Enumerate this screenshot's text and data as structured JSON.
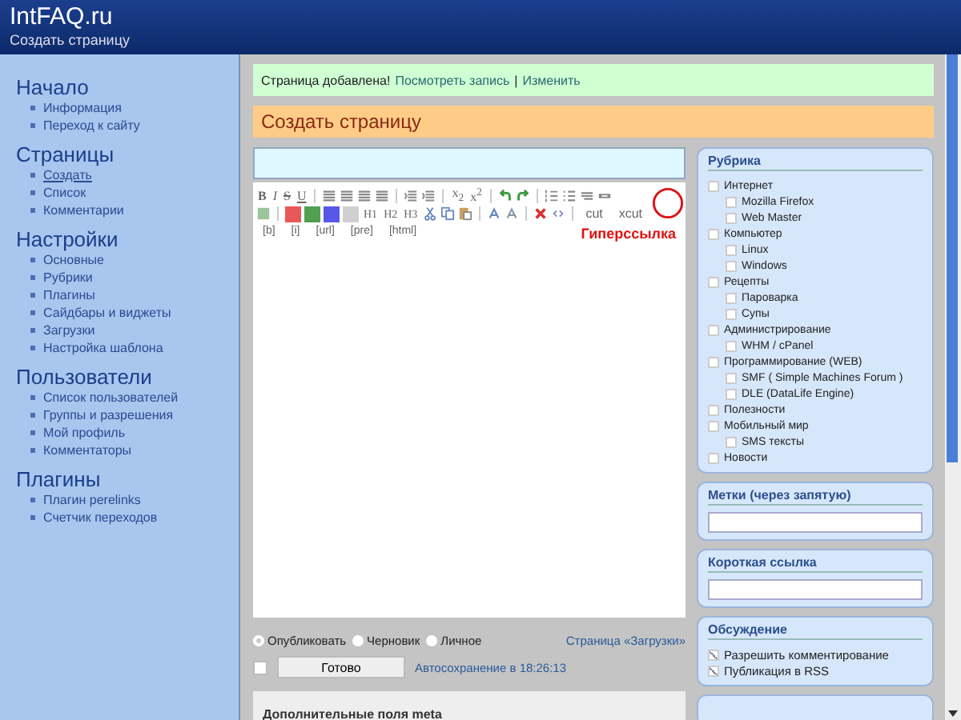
{
  "header": {
    "site_title": "IntFAQ.ru",
    "subtitle": "Создать страницу"
  },
  "sidebar": [
    {
      "title": "Начало",
      "items": [
        {
          "label": "Информация",
          "selected": false
        },
        {
          "label": "Переход к сайту",
          "selected": false
        }
      ]
    },
    {
      "title": "Страницы",
      "items": [
        {
          "label": "Создать",
          "selected": true
        },
        {
          "label": "Список",
          "selected": false
        },
        {
          "label": "Комментарии",
          "selected": false
        }
      ]
    },
    {
      "title": "Настройки",
      "items": [
        {
          "label": "Основные",
          "selected": false
        },
        {
          "label": "Рубрики",
          "selected": false
        },
        {
          "label": "Плагины",
          "selected": false
        },
        {
          "label": "Сайдбары и виджеты",
          "selected": false
        },
        {
          "label": "Загрузки",
          "selected": false
        },
        {
          "label": "Настройка шаблона",
          "selected": false
        }
      ]
    },
    {
      "title": "Пользователи",
      "items": [
        {
          "label": "Список пользователей",
          "selected": false
        },
        {
          "label": "Группы и разрешения",
          "selected": false
        },
        {
          "label": "Мой профиль",
          "selected": false
        },
        {
          "label": "Комментаторы",
          "selected": false
        }
      ]
    },
    {
      "title": "Плагины",
      "items": [
        {
          "label": "Плагин perelinks",
          "selected": false
        },
        {
          "label": "Счетчик переходов",
          "selected": false
        }
      ]
    }
  ],
  "notice": {
    "text": "Страница добавлена!",
    "links": [
      "Посмотреть запись",
      "Изменить"
    ],
    "separator": "|"
  },
  "page_title": "Создать страницу",
  "toolbar": {
    "format_buttons": [
      "B",
      "I",
      "S",
      "U"
    ],
    "script_buttons": [
      "x$_{2}$",
      "x$^{2}$"
    ],
    "colors": [
      {
        "color": "#e85858"
      },
      {
        "color": "#50a050"
      },
      {
        "color": "#5858e8"
      },
      {
        "color": "#d0d0d0"
      }
    ],
    "heading_buttons": [
      "H1",
      "H2",
      "H3"
    ],
    "text_buttons": [
      "cut",
      "xcut"
    ],
    "tag_buttons": [
      "[b]",
      "[i]",
      "[url]",
      "[pre]",
      "[html]"
    ]
  },
  "annotation": "Гиперссылка",
  "status_options": [
    {
      "label": "Опубликовать",
      "selected": true
    },
    {
      "label": "Черновик",
      "selected": false
    },
    {
      "label": "Личное",
      "selected": false
    }
  ],
  "uploads_link": "Страница «Загрузки»",
  "done": {
    "checked": false,
    "button": "Готово",
    "autosave": "Автосохранение в 18:26:13"
  },
  "meta_box": "Дополнительные поля meta",
  "categories": {
    "title": "Рубрика",
    "items": [
      {
        "label": "Интернет",
        "checked": false,
        "children": [
          {
            "label": "Mozilla Firefox",
            "checked": false
          },
          {
            "label": "Web Master",
            "checked": false
          }
        ]
      },
      {
        "label": "Компьютер",
        "checked": false,
        "children": [
          {
            "label": "Linux",
            "checked": false
          },
          {
            "label": "Windows",
            "checked": false
          }
        ]
      },
      {
        "label": "Рецепты",
        "checked": false,
        "children": [
          {
            "label": "Пароварка",
            "checked": false
          },
          {
            "label": "Супы",
            "checked": false
          }
        ]
      },
      {
        "label": "Администрирование",
        "checked": false,
        "children": [
          {
            "label": "WHM / cPanel",
            "checked": false
          }
        ]
      },
      {
        "label": "Программирование (WEB)",
        "checked": false,
        "children": [
          {
            "label": "SMF ( Simple Machines Forum )",
            "checked": false
          },
          {
            "label": "DLE (DataLife Engine)",
            "checked": false
          }
        ]
      },
      {
        "label": "Полезности",
        "checked": false
      },
      {
        "label": "Мобильный мир",
        "checked": false,
        "children": [
          {
            "label": "SMS тексты",
            "checked": false
          }
        ]
      },
      {
        "label": "Новости",
        "checked": false
      }
    ]
  },
  "tags_box": {
    "title": "Метки (через запятую)"
  },
  "shortlink_box": {
    "title": "Короткая ссылка"
  },
  "discussion": {
    "title": "Обсуждение",
    "options": [
      {
        "label": "Разрешить комментирование",
        "checked": true
      },
      {
        "label": "Публикация в RSS",
        "checked": true
      }
    ]
  }
}
